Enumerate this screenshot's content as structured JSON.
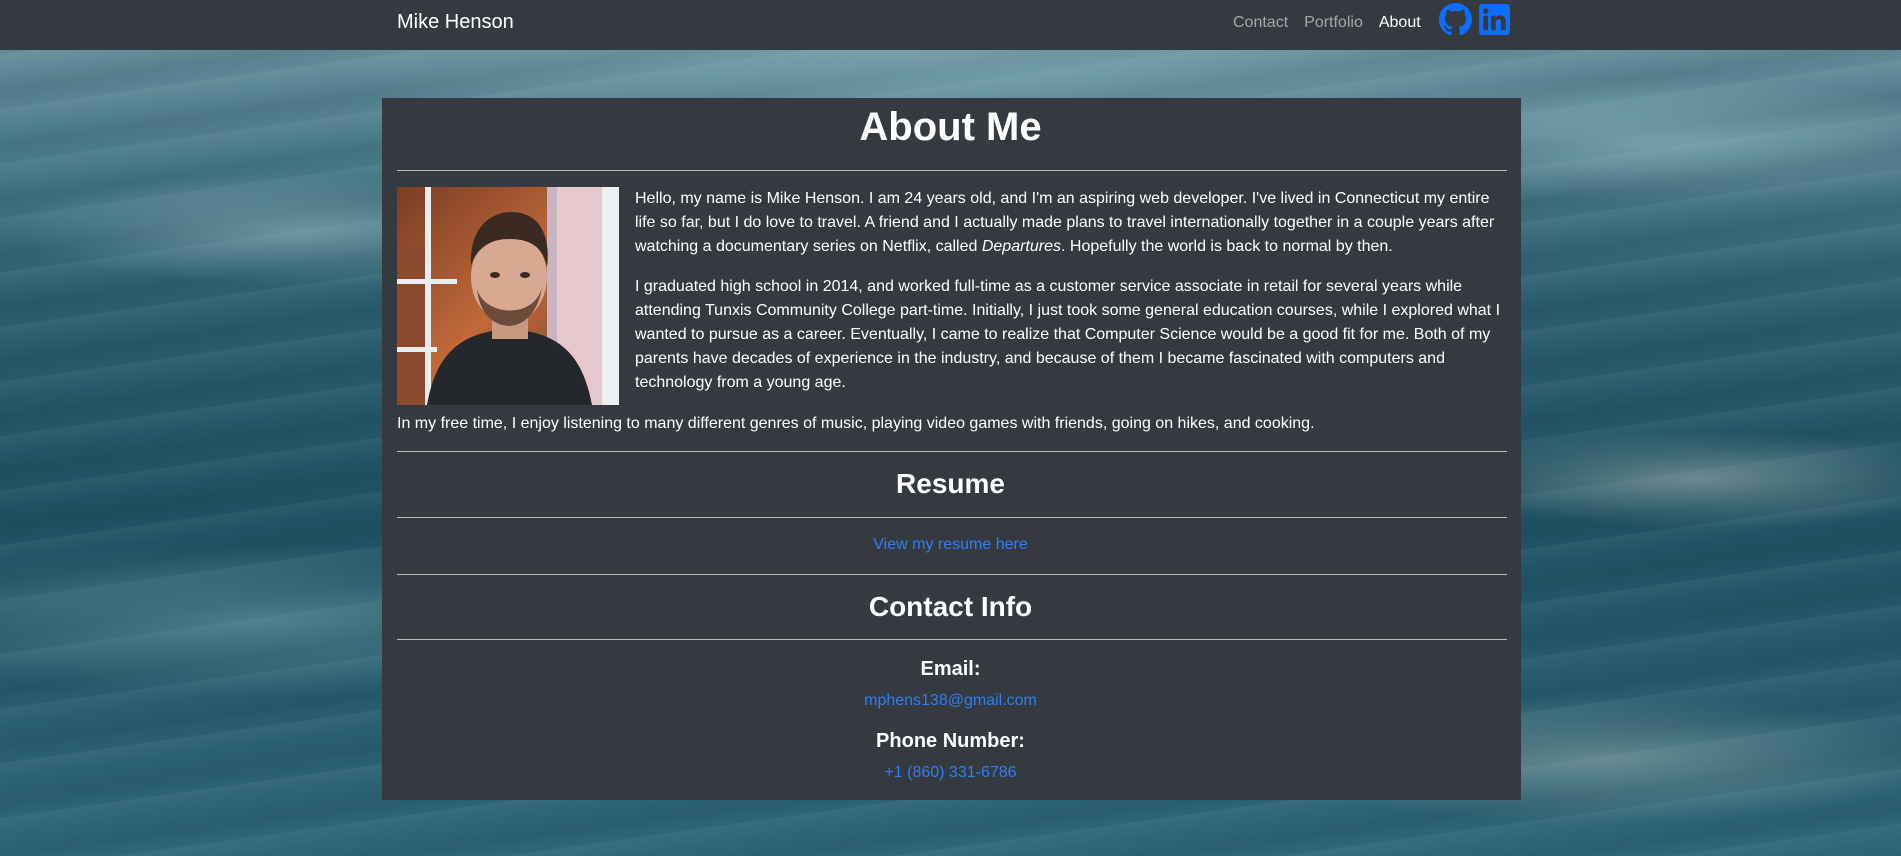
{
  "nav": {
    "brand": "Mike Henson",
    "links": [
      "Contact",
      "Portfolio",
      "About"
    ],
    "social": [
      "github-icon",
      "linkedin-icon"
    ]
  },
  "about": {
    "title": "About Me",
    "p1_before": "Hello, my name is Mike Henson. I am 24 years old, and I'm an aspiring web developer. I've lived in Connecticut my entire life so far, but I do love to travel. A friend and I actually made plans to travel internationally together in a couple years after watching a documentary series on Netflix, called ",
    "p1_italic": "Departures",
    "p1_after": ". Hopefully the world is back to normal by then.",
    "p2": "I graduated high school in 2014, and worked full-time as a customer service associate in retail for several years while attending Tunxis Community College part-time. Initially, I just took some general education courses, while I explored what I wanted to pursue as a career. Eventually, I came to realize that Computer Science would be a good fit for me. Both of my parents have decades of experience in the industry, and because of them I became fascinated with computers and technology from a young age.",
    "p3": "In my free time, I enjoy listening to many different genres of music, playing video games with friends, going on hikes, and cooking."
  },
  "resume": {
    "title": "Resume",
    "link": "View my resume here"
  },
  "contact": {
    "title": "Contact Info",
    "email_label": "Email:",
    "email": "mphens138@gmail.com",
    "phone_label": "Phone Number:",
    "phone": "+1 (860) 331-6786"
  },
  "colors": {
    "navbar": "#343a40",
    "card": "#343a40",
    "link": "#2f7ef5",
    "icon": "#0d6efd"
  }
}
